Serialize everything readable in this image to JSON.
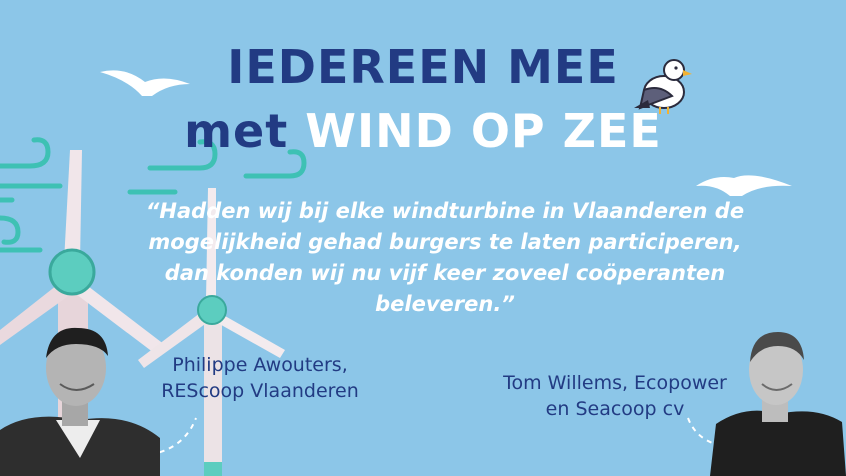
{
  "headline": {
    "line1": "IEDEREEN MEE",
    "line2_prefix": "met",
    "line2_main": "WIND OP ZEE"
  },
  "quote": {
    "text": "“Hadden wij bij elke windturbine in Vlaanderen de mogelijkheid gehad burgers te laten participeren, dan konden wij nu vijf keer zoveel coöperanten beleveren.”"
  },
  "people": [
    {
      "name": "Philippe Awouters,",
      "org": "REScoop Vlaanderen"
    },
    {
      "name": "Tom Willems, Ecopower",
      "org": "en Seacoop cv"
    }
  ],
  "colors": {
    "background": "#8cc6e8",
    "navy": "#223b83",
    "teal": "#3ec1b4",
    "turbine": "#e9e2e6"
  },
  "icons": [
    "seagull-icon",
    "flying-bird-icon",
    "wind-swirl-icon",
    "wind-turbine-icon"
  ]
}
